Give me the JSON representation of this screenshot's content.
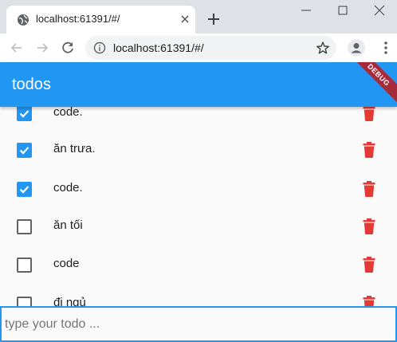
{
  "browser": {
    "tab_title": "localhost:61391/#/",
    "url": "localhost:61391/#/"
  },
  "app": {
    "title": "todos",
    "debug_banner": "DEBUG",
    "accent_color": "#2196f3",
    "delete_color": "#e53935"
  },
  "todos": [
    {
      "text": "code.",
      "done": true
    },
    {
      "text": "ăn trưa.",
      "done": true
    },
    {
      "text": "code.",
      "done": true
    },
    {
      "text": "ăn tối",
      "done": false
    },
    {
      "text": "code",
      "done": false
    },
    {
      "text": "đi ngủ",
      "done": false
    }
  ],
  "input": {
    "placeholder": "type your todo ...",
    "value": ""
  },
  "icons": {
    "favicon": "globe-icon",
    "close_tab": "close-icon",
    "new_tab": "plus-icon",
    "back": "arrow-left-icon",
    "forward": "arrow-right-icon",
    "reload": "reload-icon",
    "site_info": "info-icon",
    "bookmark": "star-icon",
    "profile": "account-icon",
    "menu": "more-vert-icon",
    "delete": "trash-icon",
    "checkbox_checked": "checkbox-checked-icon",
    "checkbox_unchecked": "checkbox-unchecked-icon"
  }
}
